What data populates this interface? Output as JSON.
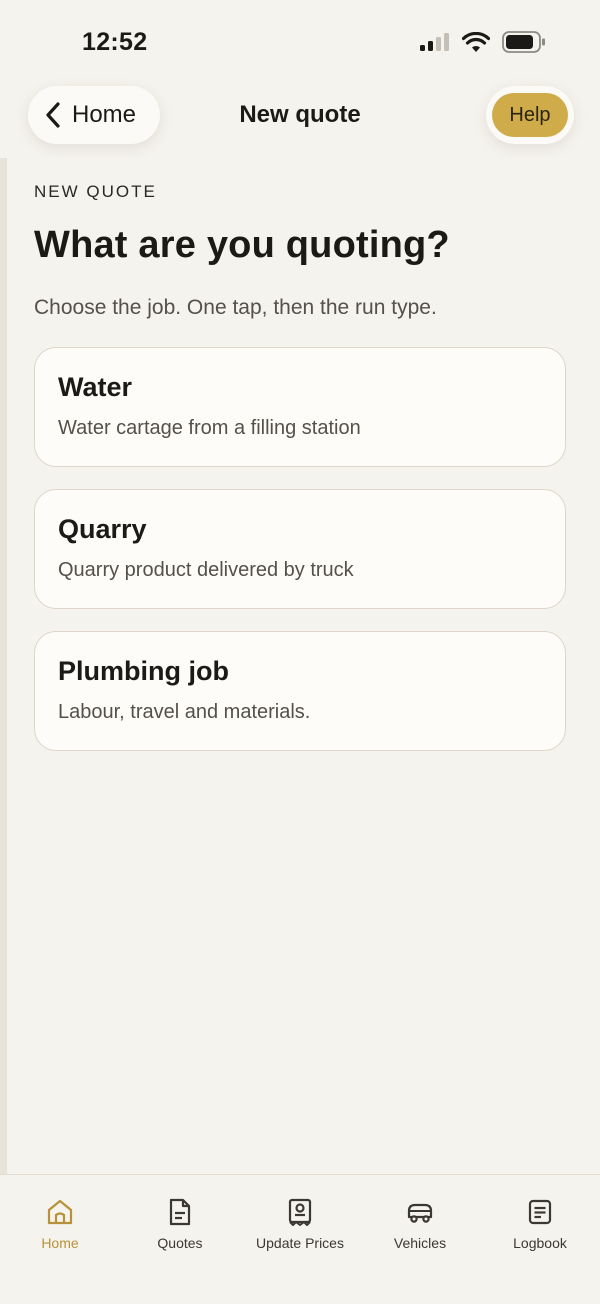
{
  "status_bar": {
    "time": "12:52"
  },
  "nav": {
    "back_label": "Home",
    "title": "New quote",
    "help_label": "Help"
  },
  "page": {
    "eyebrow": "NEW QUOTE",
    "heading": "What are you quoting?",
    "subtitle": "Choose the job. One tap, then the run type."
  },
  "options": [
    {
      "title": "Water",
      "description": "Water cartage from a filling station"
    },
    {
      "title": "Quarry",
      "description": "Quarry product delivered by truck"
    },
    {
      "title": "Plumbing job",
      "description": "Labour, travel and materials."
    }
  ],
  "tabs": [
    {
      "label": "Home",
      "icon": "home-icon",
      "active": true
    },
    {
      "label": "Quotes",
      "icon": "document-icon",
      "active": false
    },
    {
      "label": "Update Prices",
      "icon": "receipt-icon",
      "active": false
    },
    {
      "label": "Vehicles",
      "icon": "vehicle-icon",
      "active": false
    },
    {
      "label": "Logbook",
      "icon": "logbook-icon",
      "active": false
    }
  ],
  "colors": {
    "accent": "#cfab4a",
    "active_tab": "#b8923a",
    "background": "#f5f3ed"
  }
}
